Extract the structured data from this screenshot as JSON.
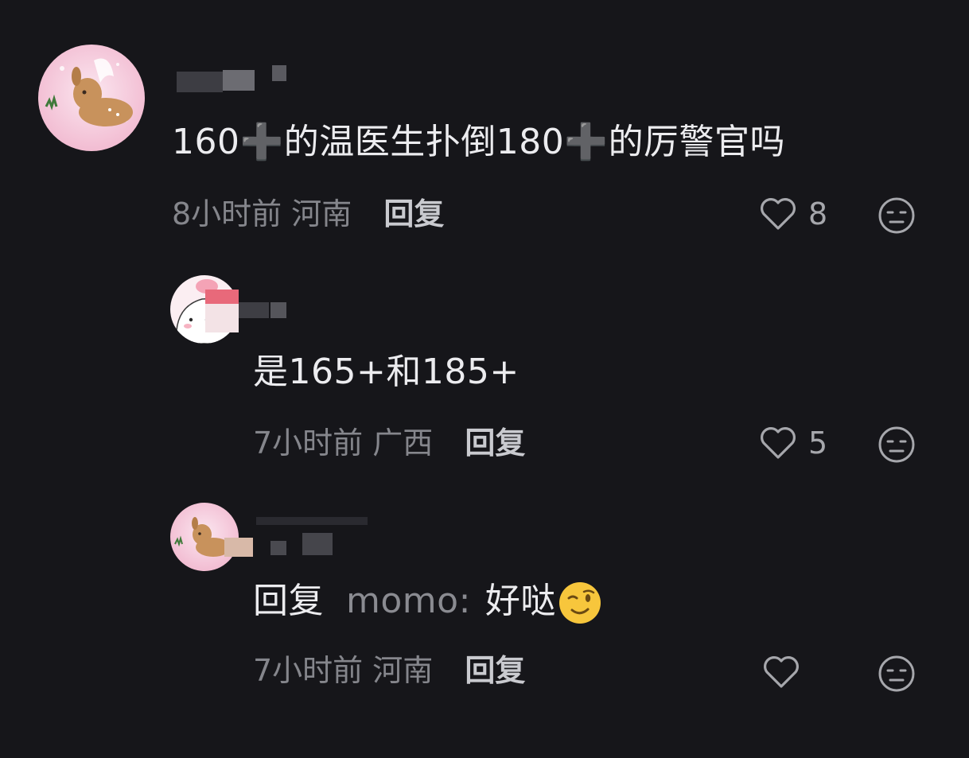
{
  "comments": [
    {
      "text_a": "160",
      "plus_a": "➕",
      "text_b": "的温医生扑倒180",
      "plus_b": "➕",
      "text_c": "的厉警官吗",
      "time": "8小时前",
      "location": "河南",
      "reply_label": "回复",
      "likes": "8"
    },
    {
      "text": "是165+和185+",
      "time": "7小时前",
      "location": "广西",
      "reply_label": "回复",
      "likes": "5"
    },
    {
      "reply_prefix": "回复",
      "mention": "momo",
      "separator": ":",
      "text": "好哒",
      "emoji": "wink-emoji",
      "time": "7小时前",
      "location": "河南",
      "reply_label": "回复",
      "likes": ""
    }
  ],
  "colors": {
    "background": "#16161a",
    "text": "#ececef",
    "meta": "#85868c",
    "reply": "#c9cacf"
  },
  "icons": {
    "like": "heart-outline-icon",
    "dislike": "neutral-face-icon"
  }
}
